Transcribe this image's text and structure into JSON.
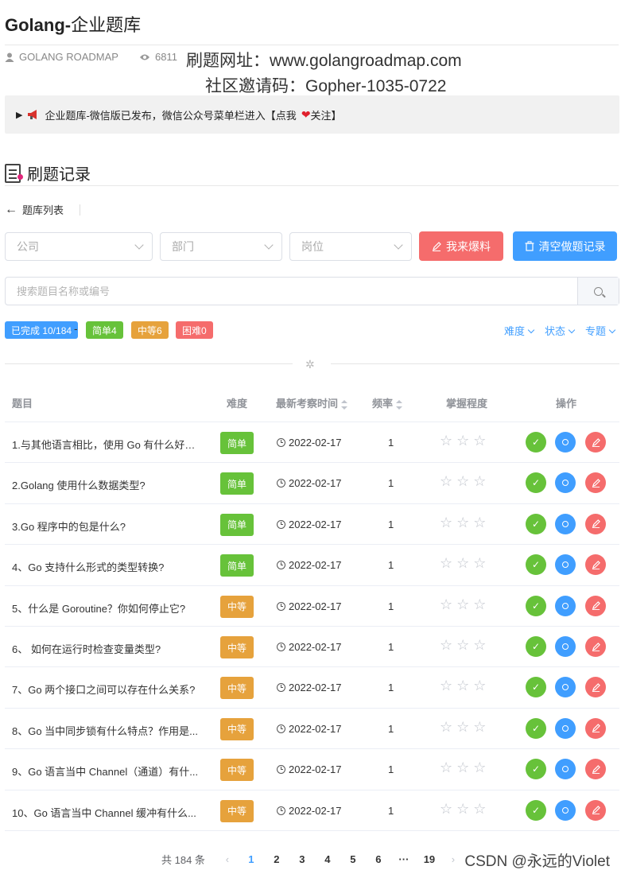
{
  "header": {
    "title_prefix": "Golang-",
    "title_cn": "企业题库",
    "author": "GOLANG ROADMAP",
    "views": "6811",
    "site_line": "刷题网址：www.golangroadmap.com",
    "invite_line": "社区邀请码：Gopher-1035-0722"
  },
  "notice": {
    "marker": "▶",
    "text_before": "企业题库-微信版已发布，微信公众号菜单栏进入【点我",
    "text_after": "关注】"
  },
  "section": {
    "title": "刷题记录"
  },
  "nav": {
    "back_label": "题库列表"
  },
  "filters_bar": {
    "company_placeholder": "公司",
    "dept_placeholder": "部门",
    "position_placeholder": "岗位",
    "report_button": "我来爆料",
    "clear_button": "清空做题记录"
  },
  "search": {
    "placeholder": "搜索题目名称或编号",
    "value": ""
  },
  "stats": {
    "completed": "已完成 10/184",
    "separator": "-",
    "easy": "简单4",
    "medium": "中等6",
    "hard": "困难0"
  },
  "dropdowns": {
    "difficulty": "难度",
    "status": "状态",
    "topic": "专题"
  },
  "table": {
    "headers": {
      "question": "题目",
      "difficulty": "难度",
      "latest": "最新考察时间",
      "frequency": "频率",
      "mastery": "掌握程度",
      "actions": "操作"
    },
    "rows": [
      {
        "q": "1.与其他语言相比，使用 Go 有什么好处...",
        "level": "简单",
        "date": "2022-02-17",
        "freq": "1"
      },
      {
        "q": "2.Golang 使用什么数据类型?",
        "level": "简单",
        "date": "2022-02-17",
        "freq": "1"
      },
      {
        "q": "3.Go 程序中的包是什么?",
        "level": "简单",
        "date": "2022-02-17",
        "freq": "1"
      },
      {
        "q": "4、Go 支持什么形式的类型转换?",
        "level": "简单",
        "date": "2022-02-17",
        "freq": "1"
      },
      {
        "q": "5、什么是 Goroutine？你如何停止它?",
        "level": "中等",
        "date": "2022-02-17",
        "freq": "1"
      },
      {
        "q": "6、 如何在运行时检查变量类型?",
        "level": "中等",
        "date": "2022-02-17",
        "freq": "1"
      },
      {
        "q": "7、Go 两个接口之间可以存在什么关系?",
        "level": "中等",
        "date": "2022-02-17",
        "freq": "1"
      },
      {
        "q": "8、Go 当中同步锁有什么特点？作用是...",
        "level": "中等",
        "date": "2022-02-17",
        "freq": "1"
      },
      {
        "q": "9、Go 语言当中 Channel（通道）有什...",
        "level": "中等",
        "date": "2022-02-17",
        "freq": "1"
      },
      {
        "q": "10、Go 语言当中 Channel 缓冲有什么...",
        "level": "中等",
        "date": "2022-02-17",
        "freq": "1"
      }
    ]
  },
  "pagination": {
    "total": "共 184 条",
    "pages": [
      "1",
      "2",
      "3",
      "4",
      "5",
      "6",
      "···",
      "19"
    ],
    "current": "1"
  },
  "watermark": "CSDN @永远的Violet",
  "colors": {
    "easy": "#67c23a",
    "medium": "#e6a23c",
    "primary": "#409eff",
    "danger": "#f56c6c"
  },
  "icons": [
    "user-icon",
    "eye-icon",
    "megaphone-icon",
    "heart-icon",
    "document-icon",
    "arrow-left-icon",
    "chevron-down-icon",
    "pencil-icon",
    "trash-icon",
    "search-icon",
    "clock-icon",
    "star-icon",
    "check-icon"
  ]
}
